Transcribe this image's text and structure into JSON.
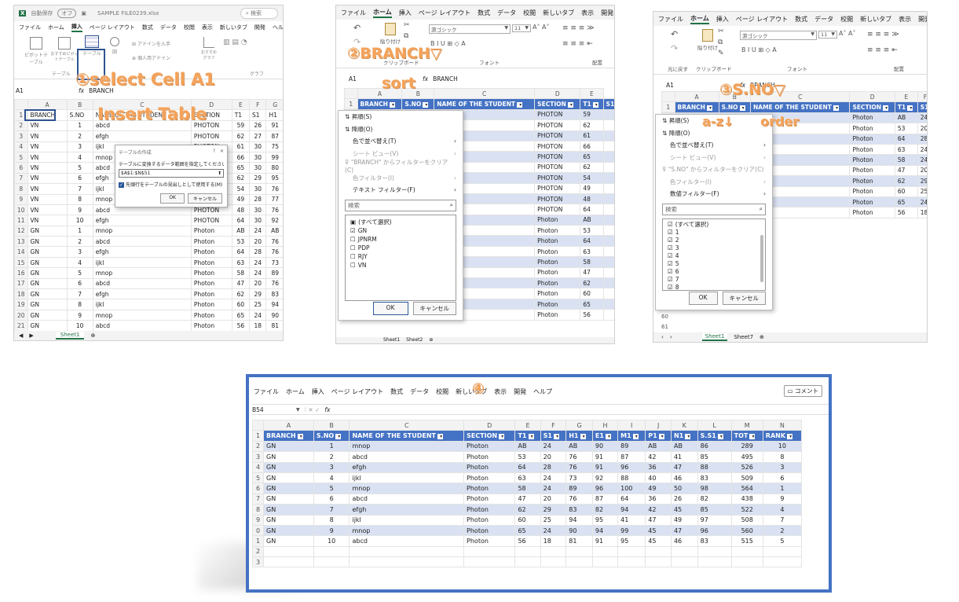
{
  "p1": {
    "autosave": "自動保存",
    "autosave_state": "オフ",
    "filename": "SAMPLE FILE0239.xlsx",
    "search": "検索",
    "menu": [
      "ファイル",
      "ホーム",
      "挿入",
      "ページ レイアウト",
      "数式",
      "データ",
      "校閲",
      "表示",
      "新しいタブ",
      "開発",
      "ヘルプ"
    ],
    "ribbon": [
      "ピボットテーブル",
      "おすすめピボットテーブル",
      "テーブル",
      "図",
      "アドインを入手",
      "個人用アドイン",
      "おすすめグラフ"
    ],
    "group_table": "テーブル",
    "group_graph": "グラフ",
    "cellref": "A1",
    "fx": "fx",
    "formula": "BRANCH",
    "cols": [
      "",
      "A",
      "B",
      "C",
      "D",
      "E",
      "F",
      "G"
    ],
    "header": [
      "BRANCH",
      "S.NO",
      "NAME OF THE STUDENT",
      "SECTION",
      "T1",
      "S1",
      "H1"
    ],
    "rows": [
      [
        "VN",
        "1",
        "abcd",
        "PHOTON",
        "59",
        "26",
        "91"
      ],
      [
        "VN",
        "2",
        "efgh",
        "PHOTON",
        "62",
        "27",
        "87"
      ],
      [
        "VN",
        "3",
        "ijkl",
        "PHOTON",
        "61",
        "30",
        "75"
      ],
      [
        "VN",
        "4",
        "mnop",
        "PHOTON",
        "66",
        "30",
        "99"
      ],
      [
        "VN",
        "5",
        "abcd",
        "PHOTON",
        "65",
        "30",
        "80"
      ],
      [
        "VN",
        "6",
        "efgh",
        "PHOTON",
        "62",
        "29",
        "95"
      ],
      [
        "VN",
        "7",
        "ijkl",
        "PHOTON",
        "54",
        "30",
        "76"
      ],
      [
        "VN",
        "8",
        "mnop",
        "PHOTON",
        "49",
        "28",
        "77"
      ],
      [
        "VN",
        "9",
        "abcd",
        "PHOTON",
        "48",
        "30",
        "76"
      ],
      [
        "VN",
        "10",
        "efgh",
        "PHOTON",
        "64",
        "30",
        "92"
      ],
      [
        "GN",
        "1",
        "mnop",
        "Photon",
        "AB",
        "24",
        "AB"
      ],
      [
        "GN",
        "2",
        "abcd",
        "Photon",
        "53",
        "20",
        "76"
      ],
      [
        "GN",
        "3",
        "efgh",
        "Photon",
        "64",
        "28",
        "76"
      ],
      [
        "GN",
        "4",
        "ijkl",
        "Photon",
        "63",
        "24",
        "73"
      ],
      [
        "GN",
        "5",
        "mnop",
        "Photon",
        "58",
        "24",
        "89"
      ],
      [
        "GN",
        "6",
        "abcd",
        "Photon",
        "47",
        "20",
        "76"
      ],
      [
        "GN",
        "7",
        "efgh",
        "Photon",
        "62",
        "29",
        "83"
      ],
      [
        "GN",
        "8",
        "ijkl",
        "Photon",
        "60",
        "25",
        "94"
      ],
      [
        "GN",
        "9",
        "mnop",
        "Photon",
        "65",
        "24",
        "90"
      ],
      [
        "GN",
        "10",
        "abcd",
        "Photon",
        "56",
        "18",
        "81"
      ]
    ],
    "dialog": {
      "title": "テーブルの作成",
      "q": "?",
      "x": "✕",
      "prompt": "テーブルに変換するデータ範囲を指定してください(W)",
      "range": "$A$1:$N$51",
      "checkbox": "先頭行をテーブルの見出しとして使用する(M)",
      "ok": "OK",
      "cancel": "キャンセル"
    },
    "sheet_tab": "Sheet1",
    "ann1": "①select Cell A1",
    "ann2": "Insert Table"
  },
  "p2": {
    "menu": [
      "ファイル",
      "ホーム",
      "挿入",
      "ページ レイアウト",
      "数式",
      "データ",
      "校閲",
      "新しいタブ",
      "表示",
      "開発"
    ],
    "paste": "貼り付け",
    "clipboard": "クリップボード",
    "font_name": "游ゴシック",
    "font_size": "11",
    "font_group": "フォント",
    "align_group": "配置",
    "cellref": "A1",
    "fx": "fx",
    "formula": "BRANCH",
    "cols": [
      "",
      "A",
      "B",
      "C",
      "D",
      "E"
    ],
    "header": [
      "BRANCH",
      "S.NO",
      "NAME OF THE STUDENT",
      "SECTION",
      "T1",
      "S1"
    ],
    "col_d": [
      "PHOTON",
      "PHOTON",
      "PHOTON",
      "PHOTON",
      "PHOTON",
      "PHOTON",
      "PHOTON",
      "PHOTON",
      "PHOTON",
      "PHOTON",
      "Photon",
      "Photon",
      "Photon",
      "Photon",
      "Photon",
      "Photon",
      "Photon",
      "Photon",
      "Photon",
      "Photon"
    ],
    "col_e": [
      "59",
      "62",
      "61",
      "66",
      "65",
      "62",
      "54",
      "49",
      "48",
      "64",
      "AB",
      "53",
      "64",
      "63",
      "58",
      "47",
      "62",
      "60",
      "65",
      "56"
    ],
    "bottom_rows": [
      [
        "20",
        "GN",
        "9",
        "mnop"
      ],
      [
        "21",
        "GN",
        "10",
        "abcd"
      ]
    ],
    "filter": {
      "asc": "昇順(S)",
      "desc": "降順(O)",
      "sort_color": "色で並べ替え(T)",
      "sheet_view": "シート ビュー(V)",
      "clear": "\"BRANCH\" からフィルターをクリア(C)",
      "color_filter": "色フィルター(I)",
      "text_filter": "テキスト フィルター(F)",
      "search": "検索",
      "items": [
        "(すべて選択)",
        "GN",
        "JPNRM",
        "PDP",
        "RJY",
        "VN"
      ],
      "checked": [
        false,
        true,
        false,
        false,
        false,
        false
      ],
      "ok": "OK",
      "cancel": "キャンセル"
    },
    "sheet_tabs": [
      "Sheet1",
      "Sheet2"
    ],
    "ann1": "②BRANCH▽",
    "ann2": "sort"
  },
  "p3": {
    "menu": [
      "ファイル",
      "ホーム",
      "挿入",
      "ページ レイアウト",
      "数式",
      "データ",
      "校閲",
      "新しいタブ",
      "表示",
      "開発"
    ],
    "paste": "貼り付け",
    "clipboard": "クリップボード",
    "undo_label": "元に戻す",
    "font_name": "游ゴシック",
    "font_size": "11",
    "font_group": "フォント",
    "align_group": "配置",
    "cellref": "A1",
    "fx": "fx",
    "formula": "BRANCH",
    "cols": [
      "",
      "A",
      "B",
      "C",
      "D",
      "E",
      "F"
    ],
    "header": [
      "BRANCH",
      "S.NO",
      "NAME OF THE STUDENT",
      "SECTION",
      "T1",
      "S1"
    ],
    "col_d": [
      "Photon",
      "Photon",
      "Photon",
      "Photon",
      "Photon",
      "Photon",
      "Photon",
      "Photon",
      "Photon",
      "Photon"
    ],
    "col_e": [
      "AB",
      "53",
      "64",
      "63",
      "58",
      "47",
      "62",
      "60",
      "65",
      "56"
    ],
    "col_f": [
      "24",
      "20",
      "28",
      "24",
      "24",
      "20",
      "29",
      "25",
      "24",
      "18"
    ],
    "extra_rows": [
      "60",
      "61"
    ],
    "filter": {
      "asc": "昇順(S)",
      "desc": "降順(O)",
      "sort_color": "色で並べ替え(T)",
      "sheet_view": "シート ビュー(V)",
      "clear": "\"S.NO\" からフィルターをクリア(C)",
      "color_filter": "色フィルター(I)",
      "num_filter": "数値フィルター(F)",
      "search": "検索",
      "items": [
        "(すべて選択)",
        "1",
        "2",
        "3",
        "4",
        "5",
        "6",
        "7",
        "8"
      ],
      "ok": "OK",
      "cancel": "キャンセル"
    },
    "sheet_tabs": [
      "Sheet1",
      "Sheet7"
    ],
    "ann1": "③S.NO▽",
    "ann2": "a-z↓",
    "ann3": "order"
  },
  "p4": {
    "menu": [
      "ファイル",
      "ホーム",
      "挿入",
      "ページ レイアウト",
      "数式",
      "データ",
      "校閲",
      "新しいタブ",
      "表示",
      "開発",
      "ヘルプ"
    ],
    "comment": "コメント",
    "cellref": "B54",
    "fx": "fx",
    "cols": [
      "",
      "A",
      "B",
      "C",
      "D",
      "E",
      "F",
      "G",
      "H",
      "I",
      "J",
      "K",
      "L",
      "M",
      "N"
    ],
    "header": [
      "BRANCH",
      "S.NO",
      "NAME OF THE STUDENT",
      "SECTION",
      "T1",
      "S1",
      "H1",
      "E1",
      "M1",
      "P1",
      "N1",
      "S.S1",
      "TOT",
      "RANK"
    ],
    "rows": [
      [
        "2",
        "GN",
        "1",
        "mnop",
        "Photon",
        "AB",
        "24",
        "AB",
        "90",
        "89",
        "AB",
        "AB",
        "86",
        "289",
        "10"
      ],
      [
        "3",
        "GN",
        "2",
        "abcd",
        "Photon",
        "53",
        "20",
        "76",
        "91",
        "87",
        "42",
        "41",
        "85",
        "495",
        "8"
      ],
      [
        "4",
        "GN",
        "3",
        "efgh",
        "Photon",
        "64",
        "28",
        "76",
        "91",
        "96",
        "36",
        "47",
        "88",
        "526",
        "3"
      ],
      [
        "5",
        "GN",
        "4",
        "ijkl",
        "Photon",
        "63",
        "24",
        "73",
        "92",
        "88",
        "40",
        "46",
        "83",
        "509",
        "6"
      ],
      [
        "6",
        "GN",
        "5",
        "mnop",
        "Photon",
        "58",
        "24",
        "89",
        "96",
        "100",
        "49",
        "50",
        "98",
        "564",
        "1"
      ],
      [
        "7",
        "GN",
        "6",
        "abcd",
        "Photon",
        "47",
        "20",
        "76",
        "87",
        "64",
        "36",
        "26",
        "82",
        "438",
        "9"
      ],
      [
        "8",
        "GN",
        "7",
        "efgh",
        "Photon",
        "62",
        "29",
        "83",
        "82",
        "94",
        "42",
        "45",
        "85",
        "522",
        "4"
      ],
      [
        "9",
        "GN",
        "8",
        "ijkl",
        "Photon",
        "60",
        "25",
        "94",
        "95",
        "41",
        "47",
        "49",
        "97",
        "508",
        "7"
      ],
      [
        "0",
        "GN",
        "9",
        "mnop",
        "Photon",
        "65",
        "24",
        "90",
        "94",
        "99",
        "45",
        "47",
        "96",
        "560",
        "2"
      ],
      [
        "1",
        "GN",
        "10",
        "abcd",
        "Photon",
        "56",
        "18",
        "81",
        "91",
        "95",
        "45",
        "46",
        "83",
        "515",
        "5"
      ]
    ],
    "empty_rows": [
      "2",
      "3"
    ],
    "ann1": "④"
  }
}
